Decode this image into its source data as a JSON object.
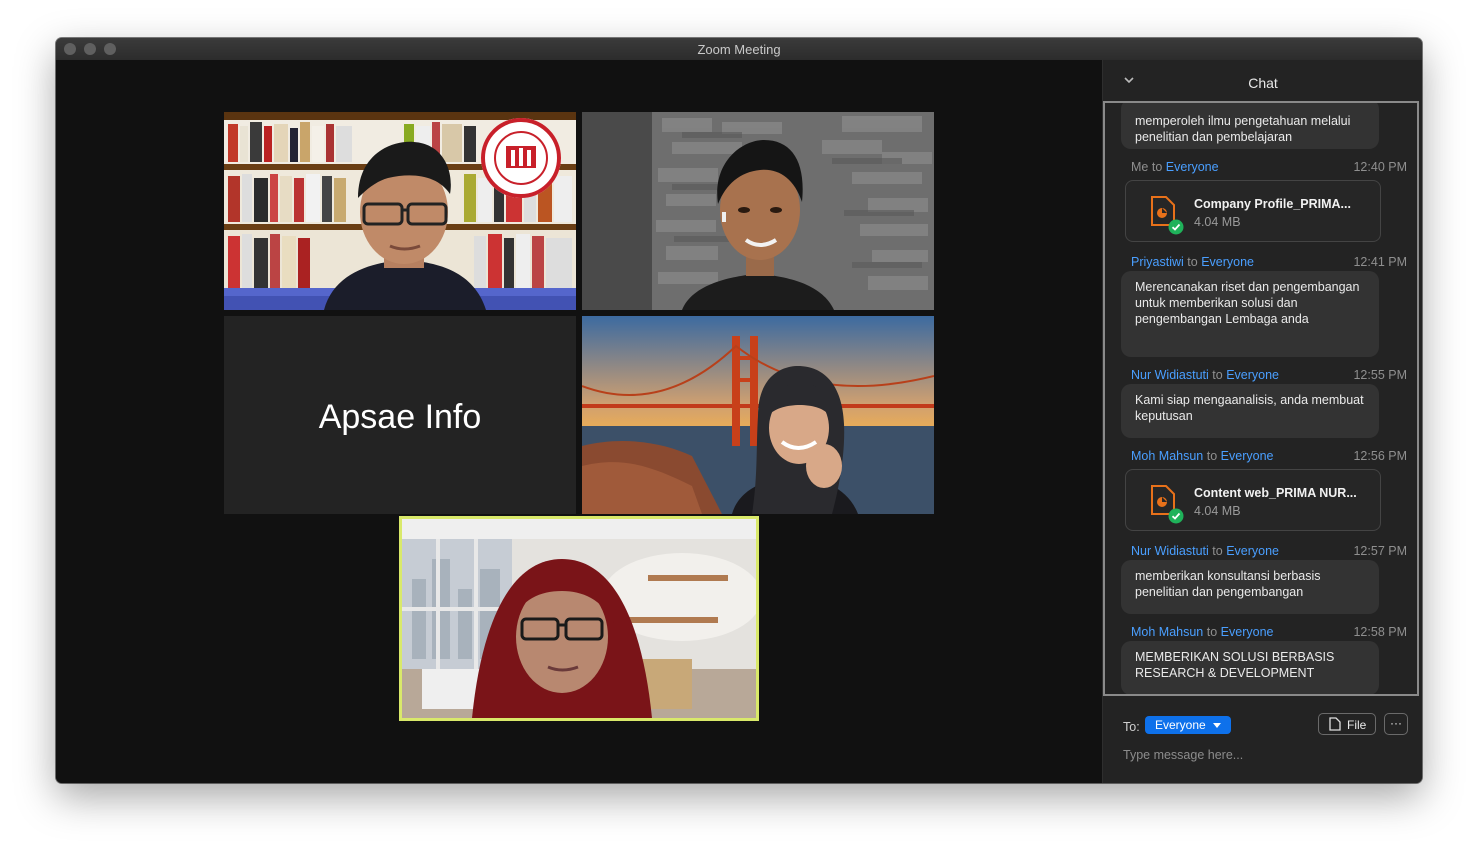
{
  "window": {
    "title": "Zoom Meeting"
  },
  "participants": {
    "apsae_label": "Apsae Info"
  },
  "chat": {
    "title": "Chat",
    "partial_message": "memperoleh ilmu pengetahuan melalui penelitian dan pembelajaran",
    "messages": [
      {
        "sender": "Me",
        "to_word": "to",
        "recipient": "Everyone",
        "time": "12:40 PM",
        "kind": "file",
        "file_name": "Company Profile_PRIMA...",
        "file_size": "4.04 MB"
      },
      {
        "sender": "Priyastiwi",
        "to_word": "to",
        "recipient": "Everyone",
        "time": "12:41 PM",
        "kind": "text",
        "text": "Merencanakan riset dan pengembangan untuk memberikan solusi dan pengembangan Lembaga anda"
      },
      {
        "sender": "Nur Widiastuti",
        "to_word": "to",
        "recipient": "Everyone",
        "time": "12:55 PM",
        "kind": "text",
        "text": "Kami siap mengaanalisis, anda membuat keputusan"
      },
      {
        "sender": "Moh Mahsun",
        "to_word": "to",
        "recipient": "Everyone",
        "time": "12:56 PM",
        "kind": "file",
        "file_name": "Content web_PRIMA NUR...",
        "file_size": "4.04 MB"
      },
      {
        "sender": "Nur Widiastuti",
        "to_word": "to",
        "recipient": "Everyone",
        "time": "12:57 PM",
        "kind": "text",
        "text": "memberikan konsultansi berbasis penelitian dan pengembangan"
      },
      {
        "sender": "Moh Mahsun",
        "to_word": "to",
        "recipient": "Everyone",
        "time": "12:58 PM",
        "kind": "text",
        "text": "MEMBERIKAN SOLUSI BERBASIS RESEARCH & DEVELOPMENT"
      }
    ],
    "composer": {
      "to_label": "To:",
      "recipient": "Everyone",
      "file_button": "File",
      "more_button": "···",
      "placeholder": "Type message here..."
    }
  },
  "colors": {
    "accent": "#0e71eb",
    "name_link": "#4a9fff",
    "active_speaker_border": "#d9e96a",
    "file_icon": "#e8711a",
    "check": "#1fb25a"
  },
  "icons": {
    "collapse": "chevron-down-icon",
    "file_type": "document-icon",
    "upload_ok": "check-circle-icon"
  }
}
